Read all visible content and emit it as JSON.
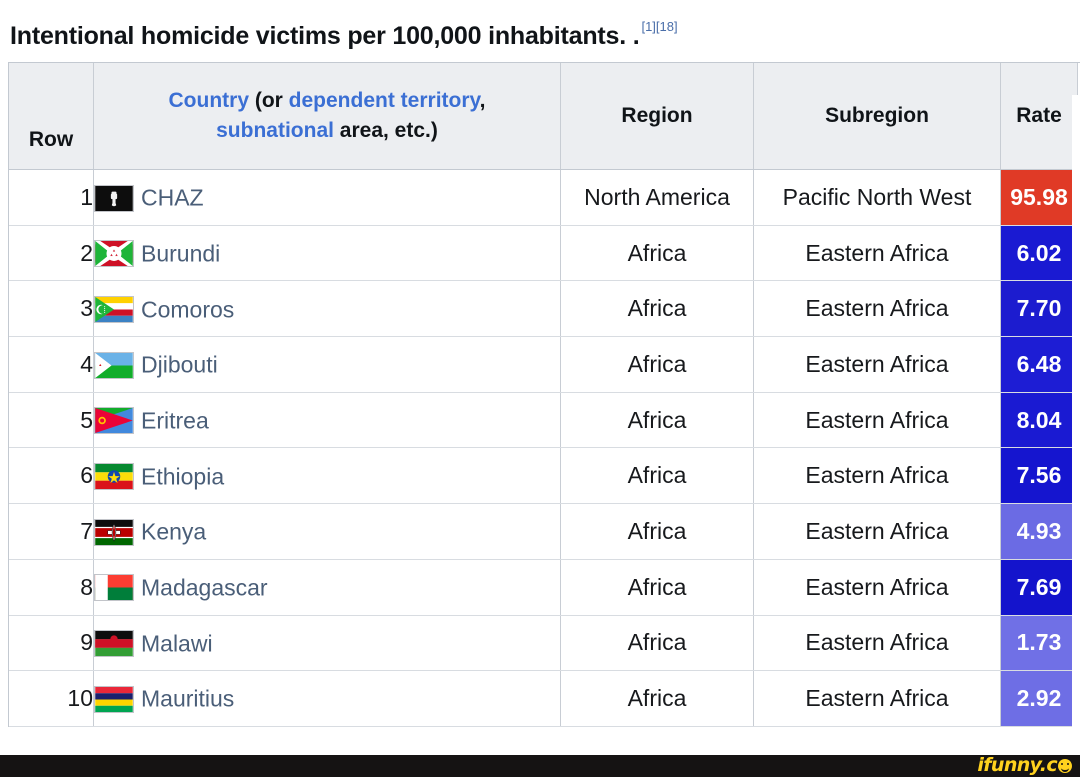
{
  "caption": {
    "text": "Intentional homicide victims per 100,000 inhabitants. .",
    "refs": "[1][18]"
  },
  "table": {
    "headers": {
      "row": "Row",
      "country_parts": {
        "link1": "Country",
        "text1": " (or ",
        "link2": "dependent territory",
        "text2": ", ",
        "link3": "subnational",
        "text3": " area, etc.)"
      },
      "region": "Region",
      "subregion": "Subregion",
      "rate": "Rate"
    },
    "rows": [
      {
        "row": "1",
        "country": "CHAZ",
        "flag": "flag-chaz",
        "region": "North America",
        "subregion": "Pacific North West",
        "rate": "95.98",
        "rate_color": "#e03a26"
      },
      {
        "row": "2",
        "country": "Burundi",
        "flag": "flag-burundi",
        "region": "Africa",
        "subregion": "Eastern Africa",
        "rate": "6.02",
        "rate_color": "#1a1ad2"
      },
      {
        "row": "3",
        "country": "Comoros",
        "flag": "flag-comoros",
        "region": "Africa",
        "subregion": "Eastern Africa",
        "rate": "7.70",
        "rate_color": "#1c1ccf"
      },
      {
        "row": "4",
        "country": "Djibouti",
        "flag": "flag-djibouti",
        "region": "Africa",
        "subregion": "Eastern Africa",
        "rate": "6.48",
        "rate_color": "#1d1dd4"
      },
      {
        "row": "5",
        "country": "Eritrea",
        "flag": "flag-eritrea",
        "region": "Africa",
        "subregion": "Eastern Africa",
        "rate": "8.04",
        "rate_color": "#1a1ad2"
      },
      {
        "row": "6",
        "country": "Ethiopia",
        "flag": "flag-ethiopia",
        "region": "Africa",
        "subregion": "Eastern Africa",
        "rate": "7.56",
        "rate_color": "#1515cf"
      },
      {
        "row": "7",
        "country": "Kenya",
        "flag": "flag-kenya",
        "region": "Africa",
        "subregion": "Eastern Africa",
        "rate": "4.93",
        "rate_color": "#6b6be4"
      },
      {
        "row": "8",
        "country": "Madagascar",
        "flag": "flag-madagascar",
        "region": "Africa",
        "subregion": "Eastern Africa",
        "rate": "7.69",
        "rate_color": "#1414cc"
      },
      {
        "row": "9",
        "country": "Malawi",
        "flag": "flag-malawi",
        "region": "Africa",
        "subregion": "Eastern Africa",
        "rate": "1.73",
        "rate_color": "#7070e6"
      },
      {
        "row": "10",
        "country": "Mauritius",
        "flag": "flag-mauritius",
        "region": "Africa",
        "subregion": "Eastern Africa",
        "rate": "2.92",
        "rate_color": "#6e6ee5"
      }
    ]
  },
  "watermark": {
    "text": "ifunny.c",
    "icon": "smiley-icon"
  },
  "colors": {
    "link": "#3b6fd4",
    "country_link": "#4a5e78",
    "header_bg": "#eceef1",
    "high_rate": "#e03a26",
    "watermark_yellow": "#ffd21e"
  }
}
